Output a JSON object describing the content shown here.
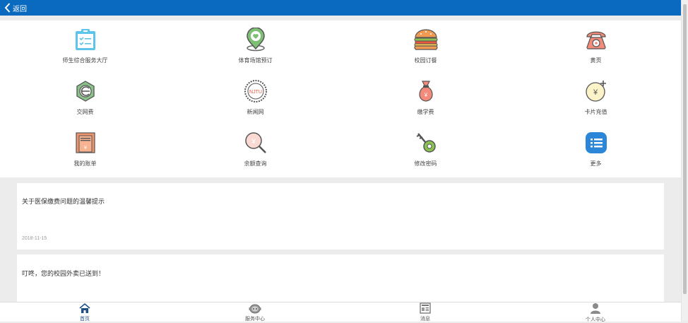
{
  "header": {
    "back_label": "返回"
  },
  "grid": {
    "items": [
      {
        "label": "师生综合服务大厅",
        "icon": "clipboard-checklist-icon"
      },
      {
        "label": "体育场馆预订",
        "icon": "location-pin-heart-icon"
      },
      {
        "label": "校园订餐",
        "icon": "burger-icon"
      },
      {
        "label": "黄页",
        "icon": "telephone-icon"
      },
      {
        "label": "交网费",
        "icon": "e-network-icon"
      },
      {
        "label": "新闻网",
        "icon": "njtu-seal-icon",
        "seal_text": "NJTU"
      },
      {
        "label": "缴学费",
        "icon": "money-bag-icon"
      },
      {
        "label": "卡片充值",
        "icon": "yen-plus-icon"
      },
      {
        "label": "我的账单",
        "icon": "bill-icon"
      },
      {
        "label": "余额查询",
        "icon": "balance-search-icon"
      },
      {
        "label": "修改密码",
        "icon": "key-icon"
      },
      {
        "label": "更多",
        "icon": "more-list-icon"
      }
    ]
  },
  "notices": [
    {
      "title": "关于医保缴费问题的温馨提示",
      "date": "2018-11-15"
    },
    {
      "title": "叮咚，您的校园外卖已送到！"
    }
  ],
  "bottom_nav": [
    {
      "label": "首页",
      "icon": "home-icon",
      "active": true
    },
    {
      "label": "服务中心",
      "icon": "service-robot-icon"
    },
    {
      "label": "消息",
      "icon": "newspaper-icon"
    },
    {
      "label": "个人中心",
      "icon": "person-icon"
    }
  ],
  "colors": {
    "header": "#0a6abf",
    "active_tab": "#1f4f86"
  }
}
